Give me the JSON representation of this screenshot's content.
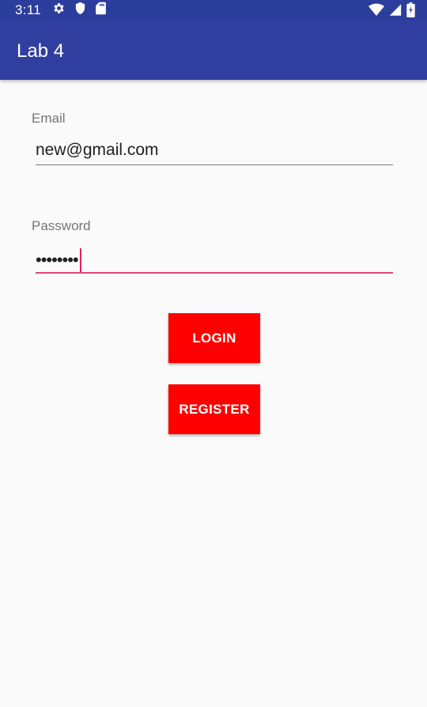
{
  "status_bar": {
    "time": "3:11",
    "icons_left": [
      "gear-icon",
      "shield-icon",
      "sd-card-icon"
    ],
    "icons_right": [
      "wifi-icon",
      "cellular-icon",
      "battery-icon"
    ],
    "background": "#2c3e9c"
  },
  "app_bar": {
    "title": "Lab 4",
    "background": "#303f9f"
  },
  "form": {
    "email_label": "Email",
    "email_value": "new@gmail.com",
    "password_label": "Password",
    "password_value": "••••••••",
    "accent_color": "#e91e63"
  },
  "buttons": {
    "login_label": "LOGIN",
    "register_label": "REGISTER",
    "color": "#ff0000"
  }
}
